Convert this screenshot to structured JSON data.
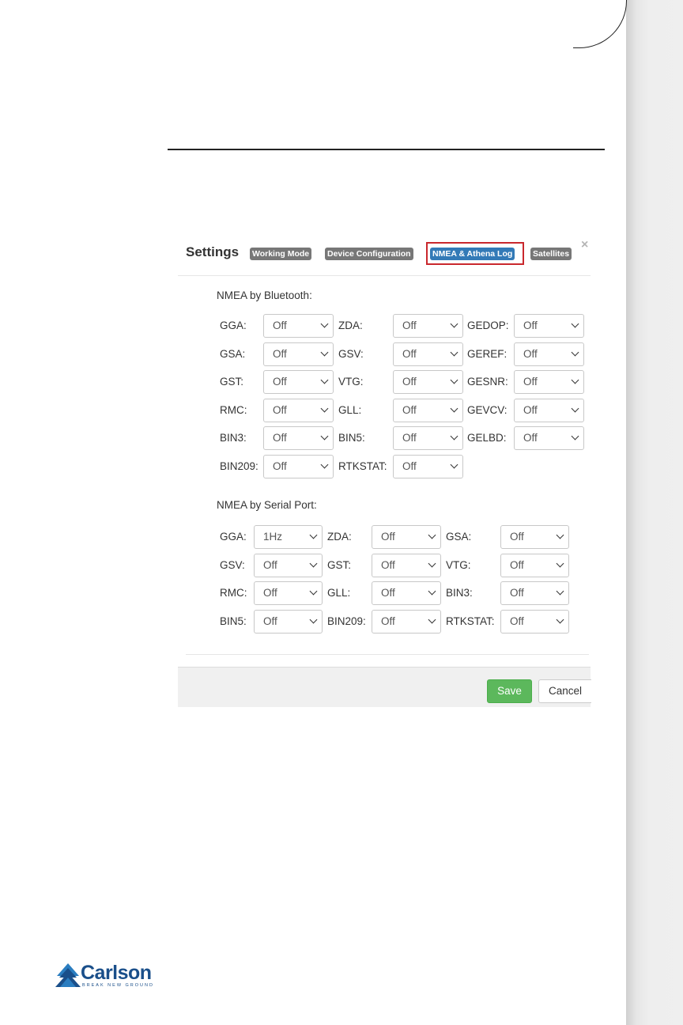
{
  "dialog": {
    "title": "Settings",
    "close_glyph": "×",
    "tabs": [
      {
        "label": "Working Mode",
        "active": false
      },
      {
        "label": "Device Configuration",
        "active": false
      },
      {
        "label": "NMEA & Athena Log",
        "active": true
      },
      {
        "label": "Satellites",
        "active": false
      }
    ],
    "bluetooth": {
      "title": "NMEA by Bluetooth:",
      "fields": [
        {
          "label": "GGA:",
          "value": "Off"
        },
        {
          "label": "ZDA:",
          "value": "Off"
        },
        {
          "label": "GEDOP:",
          "value": "Off"
        },
        {
          "label": "GSA:",
          "value": "Off"
        },
        {
          "label": "GSV:",
          "value": "Off"
        },
        {
          "label": "GEREF:",
          "value": "Off"
        },
        {
          "label": "GST:",
          "value": "Off"
        },
        {
          "label": "VTG:",
          "value": "Off"
        },
        {
          "label": "GESNR:",
          "value": "Off"
        },
        {
          "label": "RMC:",
          "value": "Off"
        },
        {
          "label": "GLL:",
          "value": "Off"
        },
        {
          "label": "GEVCV:",
          "value": "Off"
        },
        {
          "label": "BIN3:",
          "value": "Off"
        },
        {
          "label": "BIN5:",
          "value": "Off"
        },
        {
          "label": "GELBD:",
          "value": "Off"
        },
        {
          "label": "BIN209:",
          "value": "Off"
        },
        {
          "label": "RTKSTAT:",
          "value": "Off"
        }
      ]
    },
    "serial": {
      "title": "NMEA by Serial Port:",
      "fields": [
        {
          "label": "GGA:",
          "value": "1Hz"
        },
        {
          "label": "ZDA:",
          "value": "Off"
        },
        {
          "label": "GSA:",
          "value": "Off"
        },
        {
          "label": "GSV:",
          "value": "Off"
        },
        {
          "label": "GST:",
          "value": "Off"
        },
        {
          "label": "VTG:",
          "value": "Off"
        },
        {
          "label": "RMC:",
          "value": "Off"
        },
        {
          "label": "GLL:",
          "value": "Off"
        },
        {
          "label": "BIN3:",
          "value": "Off"
        },
        {
          "label": "BIN5:",
          "value": "Off"
        },
        {
          "label": "BIN209:",
          "value": "Off"
        },
        {
          "label": "RTKSTAT:",
          "value": "Off"
        }
      ]
    },
    "footer": {
      "save_label": "Save",
      "cancel_label": "Cancel"
    }
  },
  "logo": {
    "name": "Carlson",
    "tagline": "BREAK NEW GROUND",
    "color": "#1a4f8a"
  },
  "colors": {
    "active_tab": "#337ab7",
    "inactive_tab": "#777777",
    "highlight_box": "#c9282d",
    "save_button": "#5cb85c"
  }
}
